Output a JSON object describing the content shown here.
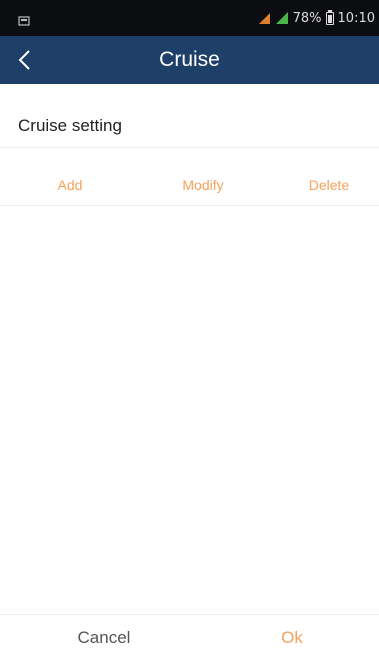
{
  "status_bar": {
    "battery": "78%",
    "time": "10:10",
    "colors": {
      "signal_1": "#e07f2a",
      "signal_2": "#49b54a"
    }
  },
  "title_bar": {
    "title": "Cruise",
    "back_icon": "chevron-left-icon",
    "background": "#1d3f68"
  },
  "section": {
    "title": "Cruise setting"
  },
  "actions": {
    "add": "Add",
    "modify": "Modify",
    "delete": "Delete",
    "accent": "#f5a15a"
  },
  "footer": {
    "cancel": "Cancel",
    "ok": "Ok"
  }
}
